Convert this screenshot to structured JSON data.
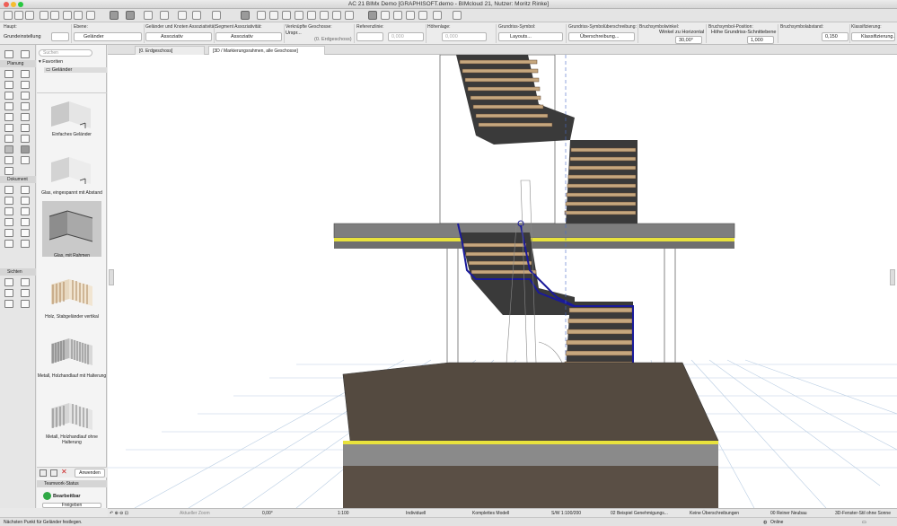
{
  "window": {
    "title": "AC 21 BIMx Demo [GRAPHISOFT.demo - BIMcloud 21, Nutzer: Moritz Rinke]"
  },
  "infobox": {
    "haupt_label": "Haupt:",
    "grundeinstellung": "Grundeinstellung",
    "ebene_label": "Ebene:",
    "ebene_value": "Geländer",
    "gelaender_assoc_label": "Geländer und Knoten Assoziativität:",
    "gelaender_assoc_value": "Assoziativ",
    "segment_assoc_label": "Segment Assoziativität:",
    "segment_assoc_value": "Assoziativ",
    "verknuepfte_label": "Verknüpfte Geschosse:",
    "verknuepfte_value": "Urspr...",
    "verknuepfte_value2": "(0. Erdgeschoss)",
    "referenzlinie_label": "Referenzlinie:",
    "referenz_value": "0,000",
    "hoehenlage_label": "Höhenlage:",
    "hoehenlage_value": "0,000",
    "grundriss_symbol_label": "Grundriss-Symbol:",
    "grundriss_symbol_value": "Layouts...",
    "grundriss_beschr_label": "Grundriss-Symbolüberschreibung:",
    "grundriss_beschr_value": "Überschreibung...",
    "bruchsymbol_winkel_label": "Bruchsymbolwinkel:",
    "bruch_winkel_mode": "Winkel zu Horizontal",
    "bruch_winkel_value": "30,00°",
    "bruchsymbol_position_label": "Bruchsymbol-Position:",
    "bruch_position_mode": "Höhe Grundriss-Schnittebene",
    "bruch_position_value": "1,000",
    "bruchsymbolabstand_label": "Bruchsymbolabstand:",
    "bruchabstand_value": "0,150",
    "klassifizierung_label": "Klassifizierung:",
    "klassifizierung_value": "Klassifizierung..."
  },
  "toolbox": {
    "planung": "Planung",
    "dokument": "Dokument",
    "sichten": "Sichten"
  },
  "favorites": {
    "search_placeholder": "Suchen",
    "root": "Favoriten",
    "folder": "Geländer",
    "items": [
      {
        "label": "Einfaches Geländer"
      },
      {
        "label": "Glas, eingespannt mit Abstand"
      },
      {
        "label": "Glas, mit Rahmen"
      },
      {
        "label": "Holz, Stabgeländer vertikal"
      },
      {
        "label": "Metall, Holzhandlauf mit Halterung"
      },
      {
        "label": "Metall, Holzhandlauf ohne Halterung"
      }
    ],
    "apply_button": "Anwenden",
    "teamwork_title": "Teamwork-Status",
    "teamwork_status": "Bearbeitbar",
    "teamwork_button": "Freigeben"
  },
  "tabs": [
    {
      "label": "[0. Erdgeschoss]"
    },
    {
      "label": "[3D / Markierungsrahmen, alle Geschosse]"
    }
  ],
  "statusbar": {
    "zoom_label": "Aktueller Zoom",
    "angle": "0,00°",
    "scale": "1:100",
    "layer_combo": "Individuell",
    "model": "Komplettes Modell",
    "pen": "S/W 1:100/200",
    "plan": "02 Beispiel Genehmigungs...",
    "dimension": "Keine Überschreibungen",
    "renovation": "00 Reiner Neubau",
    "view_style": "3D-Fenster-Stil ohne Sonne",
    "online": "Online"
  },
  "hint": "Nächsten Punkt für Geländer festlegen.",
  "colors": {
    "accent_blue": "#1a1a9a",
    "tread_wood": "#c6a77e",
    "slab_stripe": "#e8e23c",
    "teamwork_green": "#2fa845"
  }
}
